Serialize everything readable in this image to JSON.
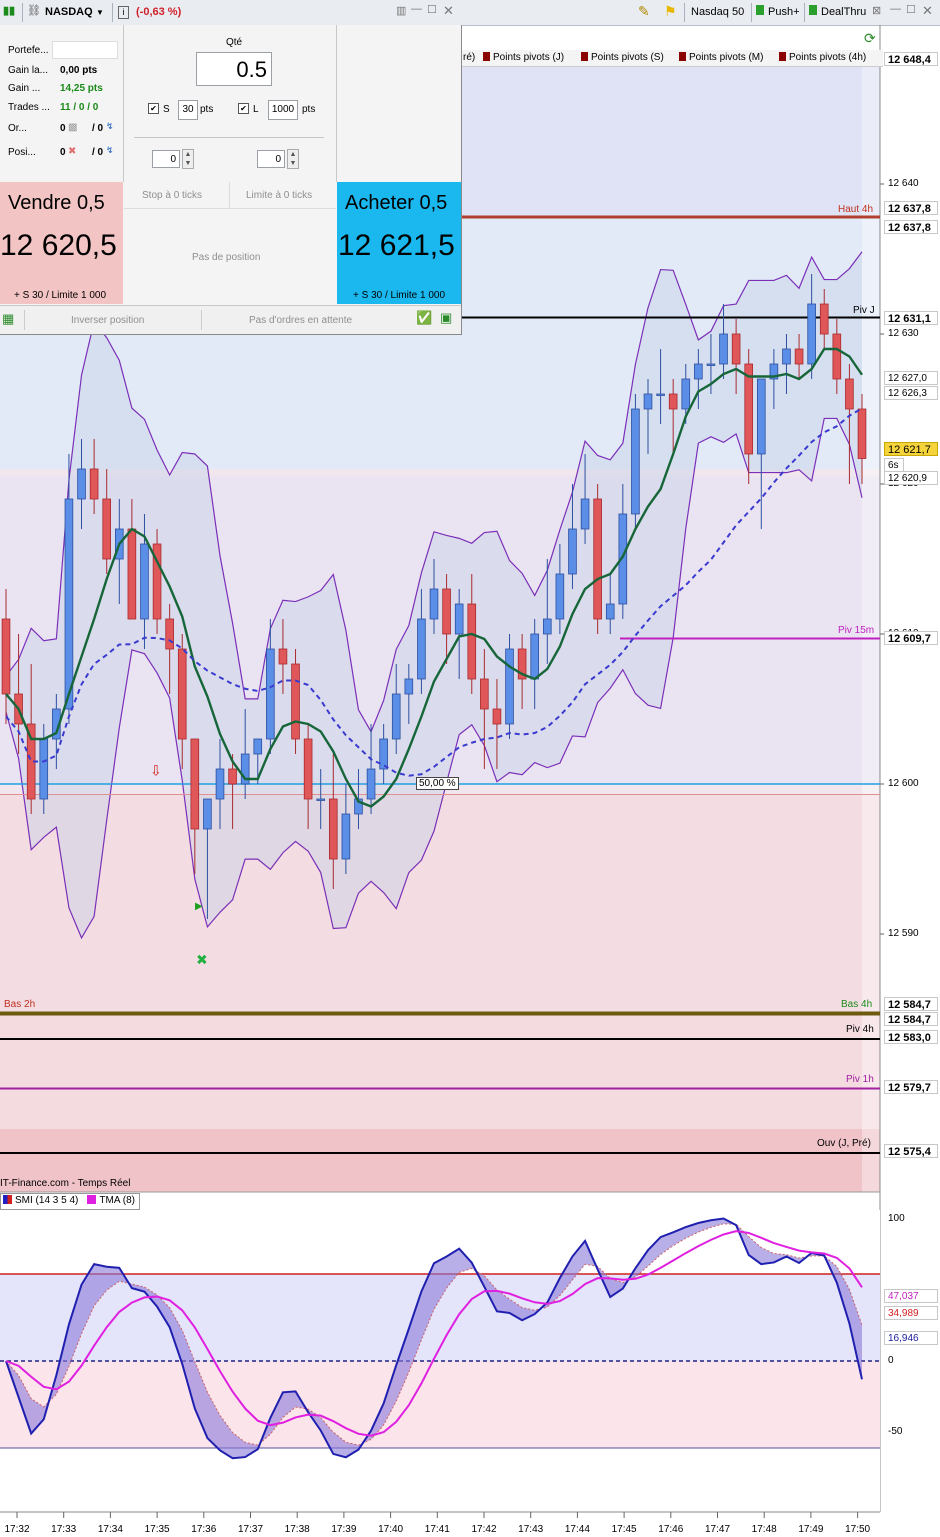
{
  "toolbar": {
    "instrument": "NASDAQ",
    "change": "(-0,63 %)",
    "info": "i",
    "nasdaq50": "Nasdaq 50",
    "push": "Push+",
    "dealthru": "DealThru"
  },
  "order_panel": {
    "portfolio_label": "Portefe...",
    "gain_latent_label": "Gain la...",
    "gain_latent_value": "0,00 pts",
    "gain_label": "Gain ...",
    "gain_value": "14,25 pts",
    "trades_label": "Trades ...",
    "trades_value": "11 / 0 / 0",
    "orders_label": "Or...",
    "orders_value_a": "0",
    "orders_value_b": "/ 0",
    "positions_label": "Posi...",
    "positions_value_a": "0",
    "positions_value_b": "/ 0",
    "qty_label": "Qté",
    "qty_value": "0.5",
    "stop_check": "S",
    "stop_value": "30",
    "stop_unit": "pts",
    "limit_check": "L",
    "limit_value": "1000",
    "limit_unit": "pts",
    "spin_left": "0",
    "spin_right": "0",
    "sell_label": "Vendre 0,5",
    "sell_price": "12 620,5",
    "sell_note": "+ S 30 / Limite 1 000",
    "stop_ticks": "Stop à 0 ticks",
    "limit_ticks": "Limite à 0 ticks",
    "no_position": "Pas de position",
    "buy_label": "Acheter 0,5",
    "buy_price": "12 621,5",
    "buy_note": "+ S 30 / Limite 1 000",
    "reverse_label": "Inverser position",
    "no_orders_label": "Pas d'ordres en attente"
  },
  "legend_tabs": [
    "ré)",
    "Points pivots (J)",
    "Points pivots (S)",
    "Points pivots (M)",
    "Points pivots (4h)"
  ],
  "watermark": "IT-Finance.com - Temps Réel",
  "price_boxes": [
    {
      "text": "12 648,4",
      "color": "#d0202a"
    },
    {
      "text": "12 637,8",
      "color": "#1a8a1a"
    },
    {
      "text": "12 637,8",
      "color": "#d0202a"
    },
    {
      "text": "12 631,1",
      "color": "#000000"
    },
    {
      "text": "12 627,0",
      "color": "#a030a0"
    },
    {
      "text": "12 626,3",
      "color": "#1a7a3a"
    },
    {
      "text": "12 621,7",
      "color": "#000000"
    },
    {
      "text": "6s",
      "color": "#000000"
    },
    {
      "text": "12 620,9",
      "color": "#a030a0"
    },
    {
      "text": "12 609,7",
      "color": "#c020c0"
    },
    {
      "text": "12 584,7",
      "color": "#1a8a1a"
    },
    {
      "text": "12 584,7",
      "color": "#d0202a"
    },
    {
      "text": "12 583,0",
      "color": "#000000"
    },
    {
      "text": "12 579,7",
      "color": "#a020a0"
    },
    {
      "text": "12 575,4",
      "color": "#000000"
    }
  ],
  "line_labels": {
    "haut4h": "Haut 4h",
    "pivj": "Piv J",
    "piv15m": "Piv 15m",
    "bas2h": "Bas 2h",
    "bas4h": "Bas 4h",
    "piv4h": "Piv 4h",
    "piv1h": "Piv 1h",
    "ouv": "Ouv (J, Pré)",
    "fib50": "50,00 %"
  },
  "indicator_legend": {
    "smi": "SMI (14 3 5 4)",
    "tma": "TMA (8)"
  },
  "indicator_boxes": [
    "47,037",
    "34,989",
    "16,946"
  ],
  "chart_data": {
    "type": "candlestick",
    "x_ticks": [
      "17:32",
      "17:33",
      "17:34",
      "17:35",
      "17:36",
      "17:37",
      "17:38",
      "17:39",
      "17:40",
      "17:41",
      "17:42",
      "17:43",
      "17:44",
      "17:45",
      "17:46",
      "17:47",
      "17:48",
      "17:49",
      "17:50"
    ],
    "y_ticks": [
      "12 640",
      "12 630",
      "12 620",
      "12 610",
      "12 600",
      "12 590"
    ],
    "y_ticks_values": [
      12640,
      12630,
      12620,
      12610,
      12600,
      12590
    ],
    "ylim": [
      12570,
      12650
    ],
    "levels": [
      {
        "name": "Haut 4h",
        "value": 12637.8,
        "color": "#b04030"
      },
      {
        "name": "Piv J",
        "value": 12631.1,
        "color": "#000000"
      },
      {
        "name": "Piv 15m",
        "value": 12609.7,
        "color": "#c020c0"
      },
      {
        "name": "50,00 %",
        "value": 12600.0,
        "color": "#20a0e0"
      },
      {
        "name": "Bas 2h / Bas 4h",
        "value": 12584.7,
        "color": "#6b5a10"
      },
      {
        "name": "Piv 4h",
        "value": 12583.0,
        "color": "#000000"
      },
      {
        "name": "Piv 1h",
        "value": 12579.7,
        "color": "#a020a0"
      },
      {
        "name": "Ouv (J, Pré)",
        "value": 12575.4,
        "color": "#000000"
      }
    ],
    "candles": [
      [
        12611,
        12613,
        12604,
        12606
      ],
      [
        12606,
        12610,
        12602,
        12604
      ],
      [
        12604,
        12608,
        12598,
        12599
      ],
      [
        12599,
        12604,
        12598,
        12603
      ],
      [
        12603,
        12606,
        12601,
        12605
      ],
      [
        12605,
        12622,
        12604,
        12619
      ],
      [
        12619,
        12623,
        12617,
        12621
      ],
      [
        12621,
        12623,
        12618,
        12619
      ],
      [
        12619,
        12621,
        12614,
        12615
      ],
      [
        12615,
        12619,
        12612,
        12617
      ],
      [
        12617,
        12619,
        12612,
        12611
      ],
      [
        12611,
        12618,
        12609,
        12616
      ],
      [
        12616,
        12617,
        12610,
        12611
      ],
      [
        12611,
        12612,
        12606,
        12609
      ],
      [
        12609,
        12610,
        12601,
        12603
      ],
      [
        12603,
        12603,
        12594,
        12597
      ],
      [
        12597,
        12599,
        12591,
        12599
      ],
      [
        12599,
        12603,
        12597,
        12601
      ],
      [
        12601,
        12602,
        12597,
        12600
      ],
      [
        12600,
        12605,
        12599,
        12602
      ],
      [
        12602,
        12603,
        12600,
        12603
      ],
      [
        12603,
        12611,
        12602,
        12609
      ],
      [
        12609,
        12611,
        12606,
        12608
      ],
      [
        12608,
        12609,
        12602,
        12603
      ],
      [
        12603,
        12604,
        12597,
        12599
      ],
      [
        12599,
        12601,
        12597,
        12599
      ],
      [
        12599,
        12602,
        12593,
        12595
      ],
      [
        12595,
        12600,
        12594,
        12598
      ],
      [
        12598,
        12601,
        12597,
        12599
      ],
      [
        12599,
        12604,
        12598,
        12601
      ],
      [
        12601,
        12604,
        12600,
        12603
      ],
      [
        12603,
        12608,
        12602,
        12606
      ],
      [
        12606,
        12608,
        12604,
        12607
      ],
      [
        12607,
        12613,
        12606,
        12611
      ],
      [
        12611,
        12615,
        12610,
        12613
      ],
      [
        12613,
        12614,
        12608,
        12610
      ],
      [
        12610,
        12613,
        12607,
        12612
      ],
      [
        12612,
        12614,
        12606,
        12607
      ],
      [
        12607,
        12609,
        12601,
        12605
      ],
      [
        12605,
        12607,
        12601,
        12604
      ],
      [
        12604,
        12610,
        12603,
        12609
      ],
      [
        12609,
        12610,
        12605,
        12607
      ],
      [
        12607,
        12611,
        12605,
        12610
      ],
      [
        12610,
        12615,
        12608,
        12611
      ],
      [
        12611,
        12616,
        12610,
        12614
      ],
      [
        12614,
        12620,
        12613,
        12617
      ],
      [
        12617,
        12622,
        12616,
        12619
      ],
      [
        12619,
        12620,
        12610,
        12611
      ],
      [
        12611,
        12614,
        12610,
        12612
      ],
      [
        12612,
        12620,
        12611,
        12618
      ],
      [
        12618,
        12626,
        12617,
        12625
      ],
      [
        12625,
        12627,
        12622,
        12626
      ],
      [
        12626,
        12629,
        12624,
        12626
      ],
      [
        12626,
        12627,
        12622,
        12625
      ],
      [
        12625,
        12628,
        12624,
        12627
      ],
      [
        12627,
        12629,
        12625,
        12628
      ],
      [
        12628,
        12630,
        12626,
        12628
      ],
      [
        12628,
        12632,
        12627,
        12630
      ],
      [
        12630,
        12631,
        12626,
        12628
      ],
      [
        12628,
        12629,
        12620,
        12622
      ],
      [
        12622,
        12627,
        12617,
        12627
      ],
      [
        12627,
        12629,
        12625,
        12628
      ],
      [
        12628,
        12630,
        12626,
        12629
      ],
      [
        12629,
        12630,
        12627,
        12628
      ],
      [
        12628,
        12634,
        12627,
        12632
      ],
      [
        12632,
        12633,
        12629,
        12630
      ],
      [
        12630,
        12631,
        12626,
        12627
      ],
      [
        12627,
        12628,
        12620,
        12625
      ],
      [
        12625,
        12626,
        12620,
        12621.7
      ]
    ]
  }
}
